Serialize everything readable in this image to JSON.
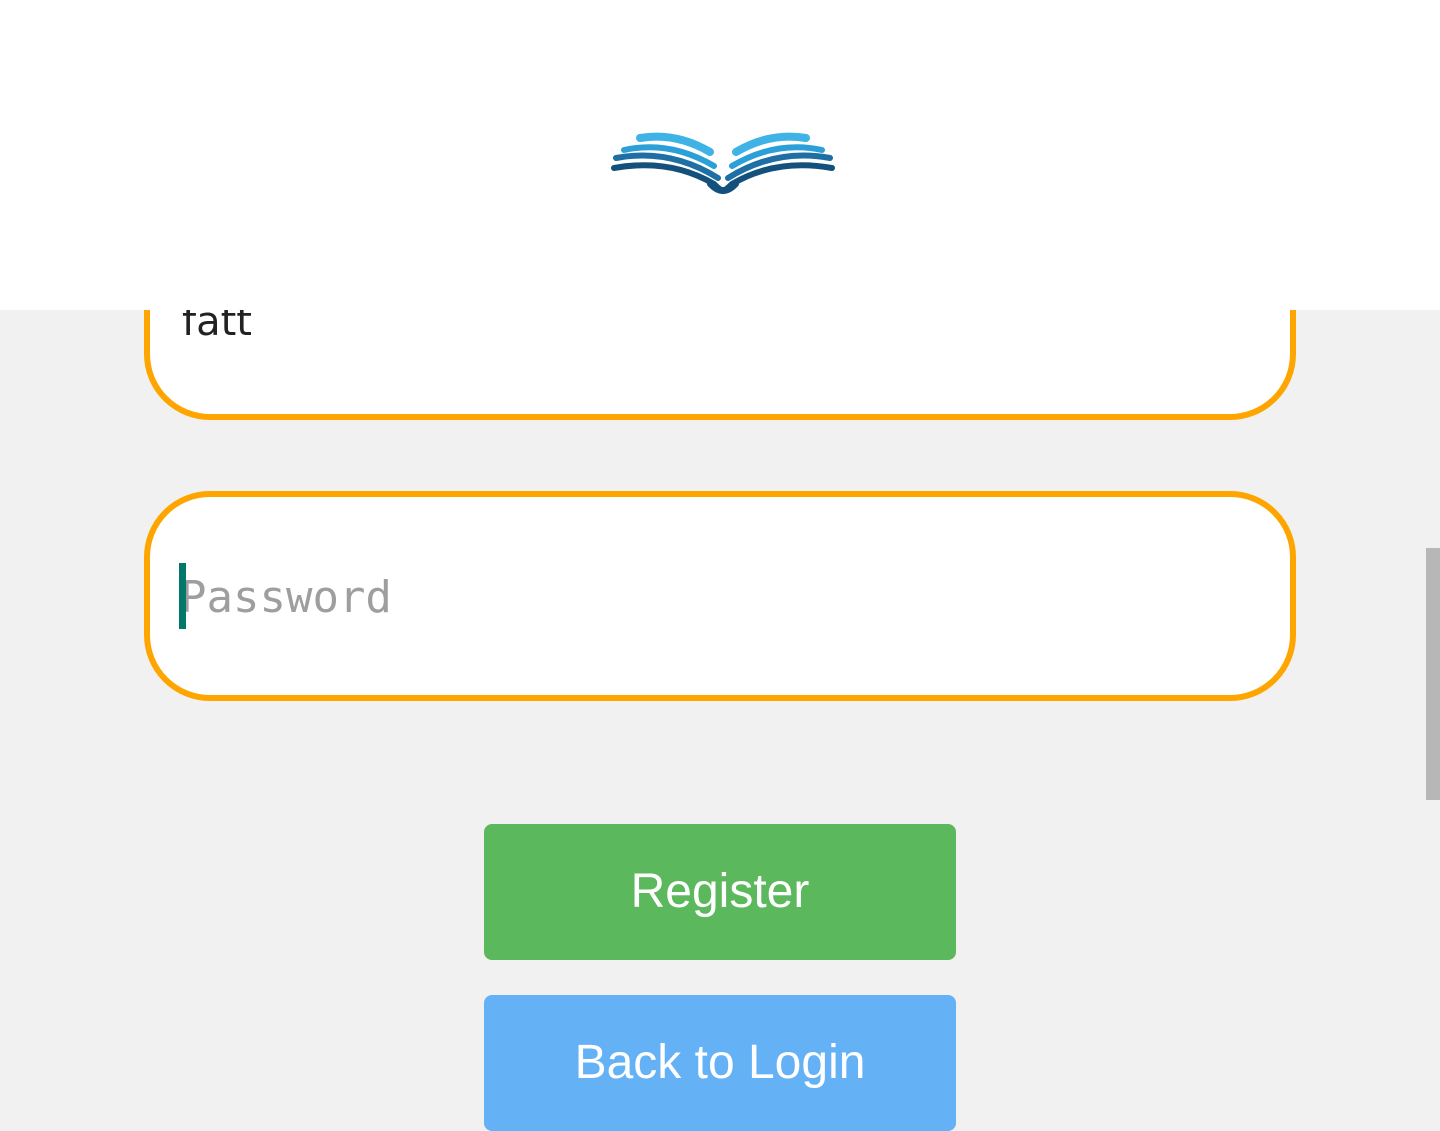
{
  "header": {
    "logo_icon": "open-book-icon",
    "colors": {
      "light_blue": "#2ea3dc",
      "dark_blue": "#14507c"
    }
  },
  "form": {
    "username_value": "fatt",
    "password_placeholder": "Password",
    "password_value": "",
    "field_border_color": "#ffa500"
  },
  "buttons": {
    "register_label": "Register",
    "register_color": "#5cb85c",
    "back_label": "Back to Login",
    "back_color": "#64b1f6"
  }
}
